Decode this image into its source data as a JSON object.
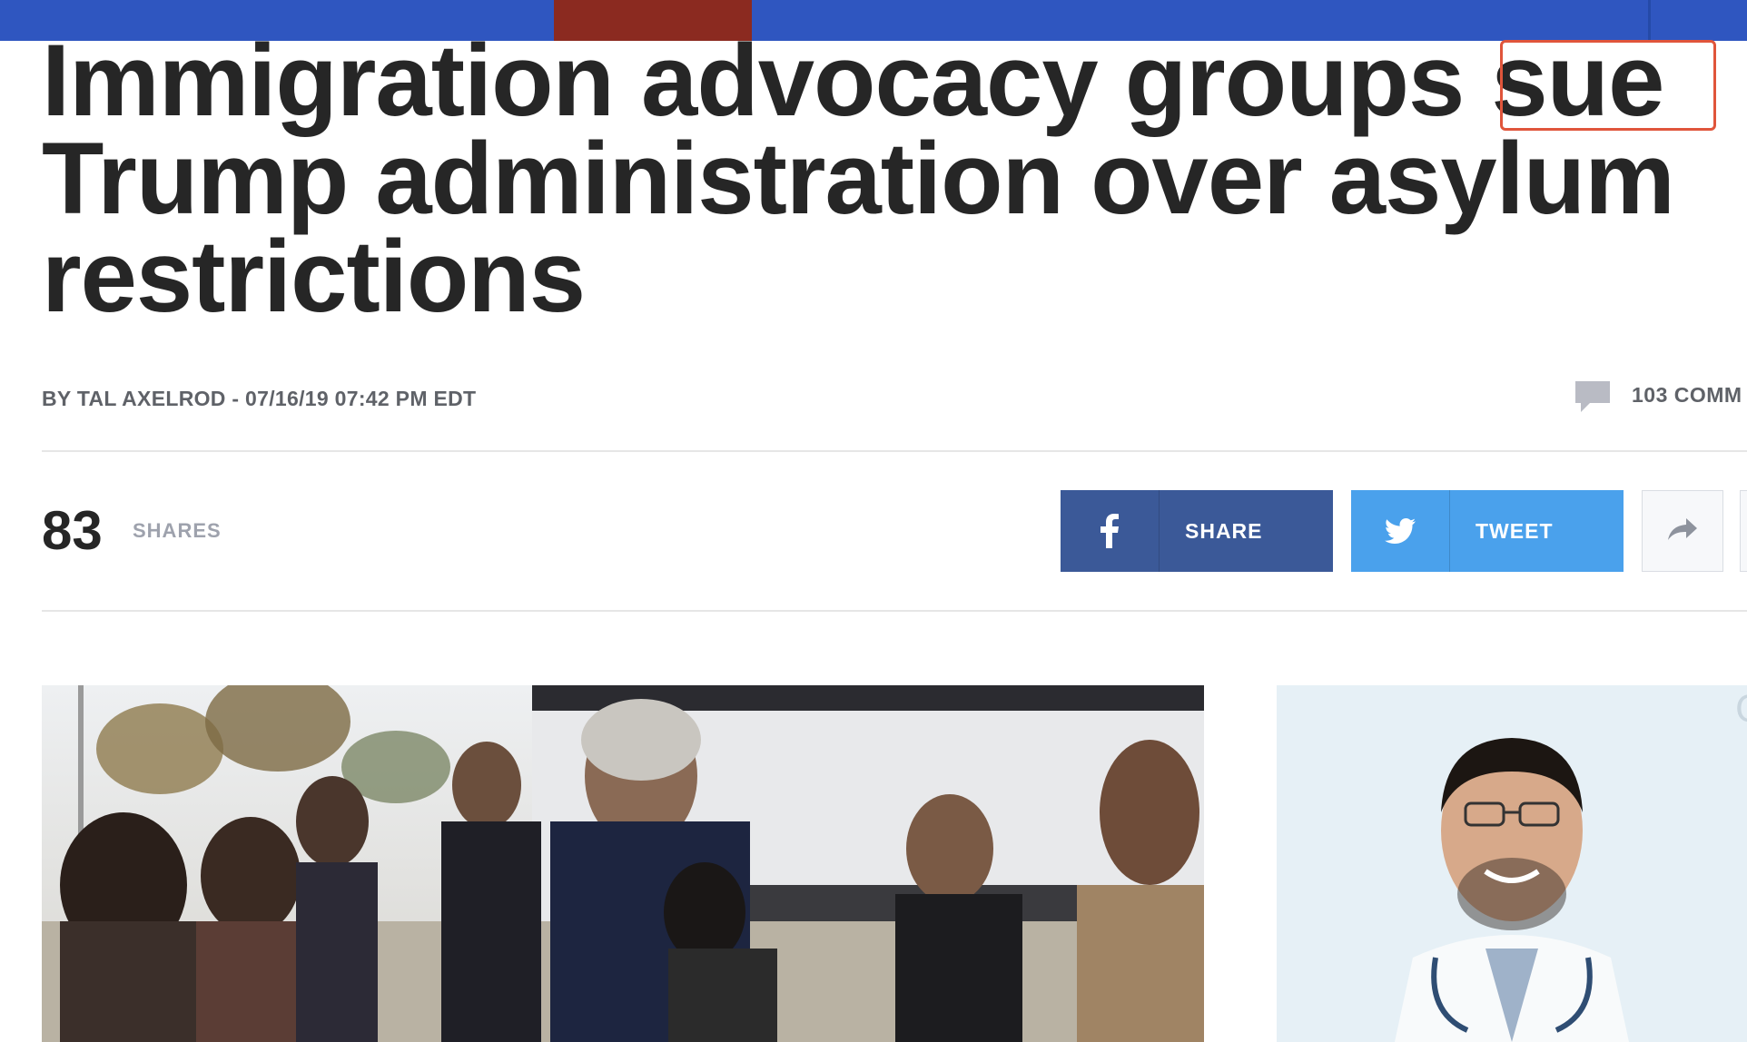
{
  "headline": {
    "lines": [
      "Immigration advocacy groups sue",
      "Trump administration over asylum",
      "restrictions"
    ]
  },
  "byline": "BY TAL AXELROD - 07/16/19 07:42 PM EDT",
  "comments": {
    "count_label": "103 COMM",
    "icon": "comment-bubble-icon"
  },
  "shares": {
    "count": "83",
    "label": "SHARES"
  },
  "share_buttons": {
    "facebook": {
      "label": "SHARE",
      "icon": "facebook-icon",
      "color": "#3b5998"
    },
    "twitter": {
      "label": "TWEET",
      "icon": "twitter-icon",
      "color": "#4aa1ec"
    },
    "more": {
      "icon": "share-arrow-icon"
    }
  },
  "colors": {
    "topbar": "#2f56c0",
    "topbar_accent": "#8b2a20",
    "highlight_box": "#e0553b"
  },
  "images": {
    "main": "photo of man hugging a boy among a group of migrants near a bus",
    "side": "ad photo of smiling doctor with glasses and stethoscope"
  }
}
